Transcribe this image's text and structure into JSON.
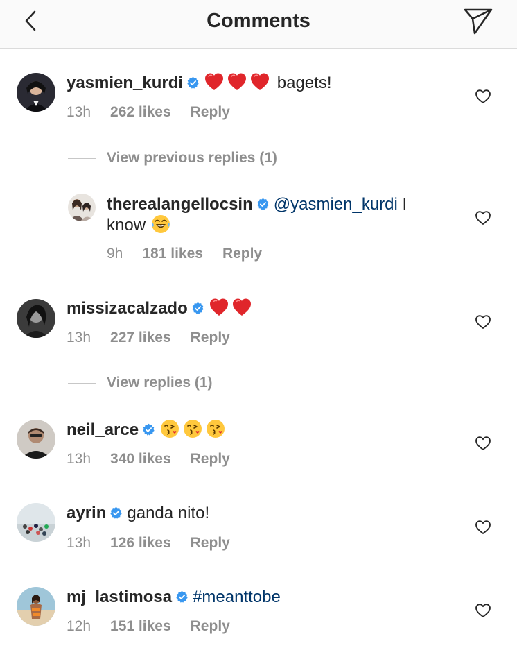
{
  "header": {
    "title": "Comments",
    "back_icon": "chevron-left-icon",
    "send_icon": "paper-plane-icon"
  },
  "colors": {
    "text": "#262626",
    "secondary": "#8e8e8e",
    "verified": "#3897f0",
    "link": "#003569",
    "heart_emoji": "#e0262b",
    "kiss_emoji": "#ffb020"
  },
  "comments": [
    {
      "username": "yasmien_kurdi",
      "verified": true,
      "emojis": [
        "red-heart-emoji",
        "red-heart-emoji",
        "red-heart-emoji"
      ],
      "text": "bagets!",
      "time": "13h",
      "likes": "262 likes",
      "reply": "Reply",
      "view_replies": "View previous replies (1)"
    },
    {
      "username": "therealangellocsin",
      "verified": true,
      "mention": "@yasmien_kurdi",
      "text_after_mention": " I",
      "text_line2": "know",
      "emojis": [
        "tears-of-joy-emoji"
      ],
      "time": "9h",
      "likes": "181 likes",
      "reply": "Reply"
    },
    {
      "username": "missizacalzado",
      "verified": true,
      "emojis": [
        "red-heart-emoji",
        "red-heart-emoji"
      ],
      "time": "13h",
      "likes": "227 likes",
      "reply": "Reply",
      "view_replies": "View replies (1)"
    },
    {
      "username": "neil_arce",
      "verified": true,
      "emojis": [
        "face-blowing-kiss-emoji",
        "face-blowing-kiss-emoji",
        "face-blowing-kiss-emoji"
      ],
      "time": "13h",
      "likes": "340 likes",
      "reply": "Reply"
    },
    {
      "username": "ayrin",
      "verified": true,
      "text": "ganda nito!",
      "time": "13h",
      "likes": "126 likes",
      "reply": "Reply"
    },
    {
      "username": "mj_lastimosa",
      "verified": true,
      "hashtag": "#meanttobe",
      "time": "12h",
      "likes": "151 likes",
      "reply": "Reply"
    }
  ]
}
